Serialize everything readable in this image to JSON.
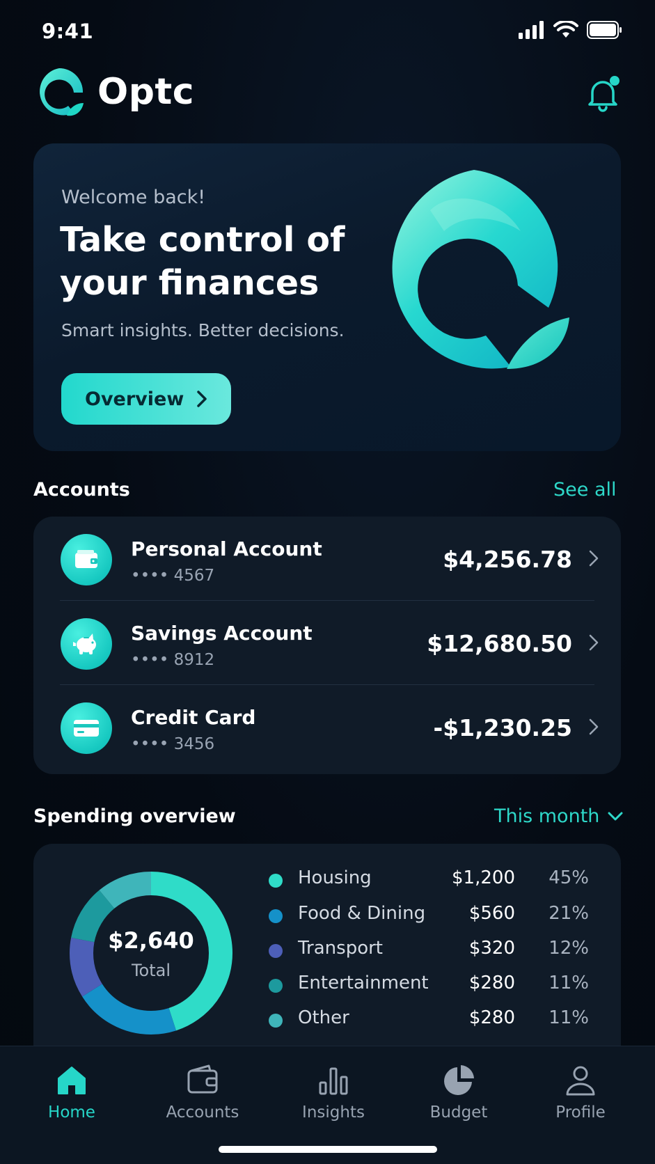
{
  "status": {
    "time": "9:41"
  },
  "brand": {
    "name": "Optc",
    "accent": "#22d8cd"
  },
  "hero": {
    "welcome": "Welcome back!",
    "title": "Take control of your finances",
    "subtitle": "Smart insights. Better decisions.",
    "button_label": "Overview"
  },
  "accounts": {
    "title": "Accounts",
    "see_all": "See all",
    "items": [
      {
        "name": "Personal Account",
        "number": "•••• 4567",
        "balance": "$4,256.78",
        "icon": "wallet-icon"
      },
      {
        "name": "Savings Account",
        "number": "•••• 8912",
        "balance": "$12,680.50",
        "icon": "piggy-bank-icon"
      },
      {
        "name": "Credit Card",
        "number": "•••• 3456",
        "balance": "-$1,230.25",
        "icon": "credit-card-icon"
      }
    ]
  },
  "spending": {
    "title": "Spending overview",
    "period": "This month",
    "total": "$2,640",
    "total_label": "Total",
    "categories": [
      {
        "name": "Housing",
        "amount": "$1,200",
        "percent": "45%",
        "value": 45,
        "color": "#2fdcc8"
      },
      {
        "name": "Food & Dining",
        "amount": "$560",
        "percent": "21%",
        "value": 21,
        "color": "#1591c9"
      },
      {
        "name": "Transport",
        "amount": "$320",
        "percent": "12%",
        "value": 12,
        "color": "#4d5fb8"
      },
      {
        "name": "Entertainment",
        "amount": "$280",
        "percent": "11%",
        "value": 11,
        "color": "#1d9a9e"
      },
      {
        "name": "Other",
        "amount": "$280",
        "percent": "11%",
        "value": 11,
        "color": "#3fb5ba"
      }
    ]
  },
  "tabs": [
    {
      "label": "Home",
      "icon": "home-icon",
      "active": true
    },
    {
      "label": "Accounts",
      "icon": "wallet-icon",
      "active": false
    },
    {
      "label": "Insights",
      "icon": "bar-chart-icon",
      "active": false
    },
    {
      "label": "Budget",
      "icon": "pie-chart-icon",
      "active": false
    },
    {
      "label": "Profile",
      "icon": "person-icon",
      "active": false
    }
  ]
}
